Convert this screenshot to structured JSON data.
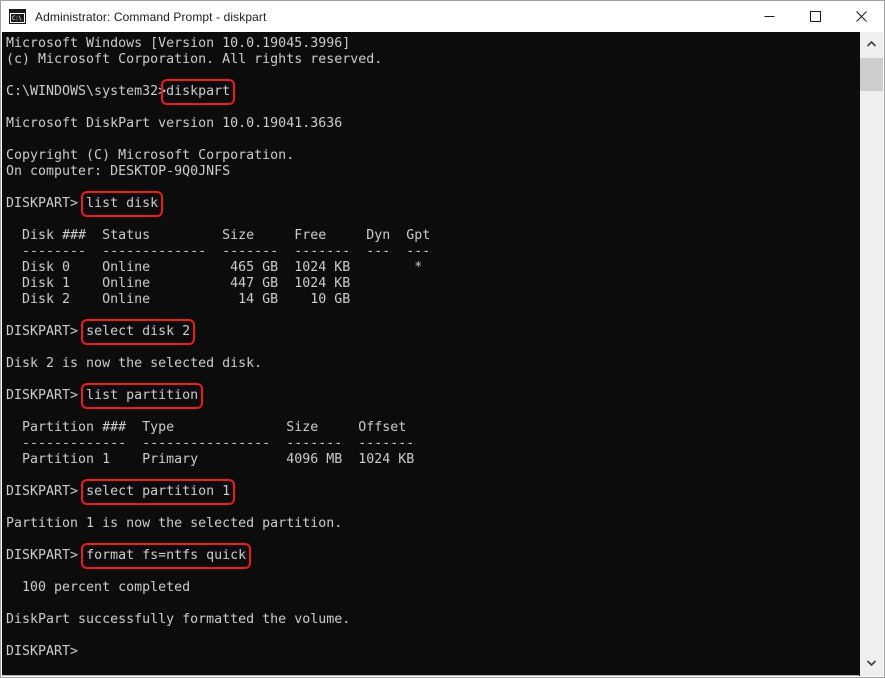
{
  "window": {
    "title": "Administrator: Command Prompt - diskpart",
    "icon": "command-prompt-icon",
    "icon_text": "C:\\",
    "controls": {
      "minimize": "minimize-button",
      "maximize": "maximize-button",
      "close": "close-button"
    }
  },
  "theme": {
    "console_bg": "#0c0c0c",
    "console_fg": "#cccccc",
    "titlebar_bg": "#ffffff",
    "titlebar_fg": "#1b1b1b",
    "highlight": "#ef1b1b",
    "scrollbar_track": "#efefef",
    "scrollbar_thumb": "#cdcdcd"
  },
  "scrollbar": {
    "up_arrow": "scroll-up-arrow",
    "down_arrow": "scroll-down-arrow",
    "thumb": "scroll-thumb"
  },
  "terminal": {
    "lines": [
      {
        "text": "Microsoft Windows [Version 10.0.19045.3996]"
      },
      {
        "text": "(c) Microsoft Corporation. All rights reserved."
      },
      {
        "text": ""
      },
      {
        "prefix": "C:\\WINDOWS\\system32>",
        "highlight": "diskpart"
      },
      {
        "text": ""
      },
      {
        "text": "Microsoft DiskPart version 10.0.19041.3636"
      },
      {
        "text": ""
      },
      {
        "text": "Copyright (C) Microsoft Corporation."
      },
      {
        "text": "On computer: DESKTOP-9Q0JNFS"
      },
      {
        "text": ""
      },
      {
        "prefix": "DISKPART> ",
        "highlight": "list disk"
      },
      {
        "text": ""
      },
      {
        "text": "  Disk ###  Status         Size     Free     Dyn  Gpt"
      },
      {
        "text": "  --------  -------------  -------  -------  ---  ---"
      },
      {
        "text": "  Disk 0    Online          465 GB  1024 KB        *"
      },
      {
        "text": "  Disk 1    Online          447 GB  1024 KB"
      },
      {
        "text": "  Disk 2    Online           14 GB    10 GB"
      },
      {
        "text": ""
      },
      {
        "prefix": "DISKPART> ",
        "highlight": "select disk 2"
      },
      {
        "text": ""
      },
      {
        "text": "Disk 2 is now the selected disk."
      },
      {
        "text": ""
      },
      {
        "prefix": "DISKPART> ",
        "highlight": "list partition"
      },
      {
        "text": ""
      },
      {
        "text": "  Partition ###  Type              Size     Offset"
      },
      {
        "text": "  -------------  ----------------  -------  -------"
      },
      {
        "text": "  Partition 1    Primary           4096 MB  1024 KB"
      },
      {
        "text": ""
      },
      {
        "prefix": "DISKPART> ",
        "highlight": "select partition 1"
      },
      {
        "text": ""
      },
      {
        "text": "Partition 1 is now the selected partition."
      },
      {
        "text": ""
      },
      {
        "prefix": "DISKPART> ",
        "highlight": "format fs=ntfs quick"
      },
      {
        "text": ""
      },
      {
        "text": "  100 percent completed"
      },
      {
        "text": ""
      },
      {
        "text": "DiskPart successfully formatted the volume."
      },
      {
        "text": ""
      },
      {
        "text": "DISKPART>"
      }
    ]
  }
}
